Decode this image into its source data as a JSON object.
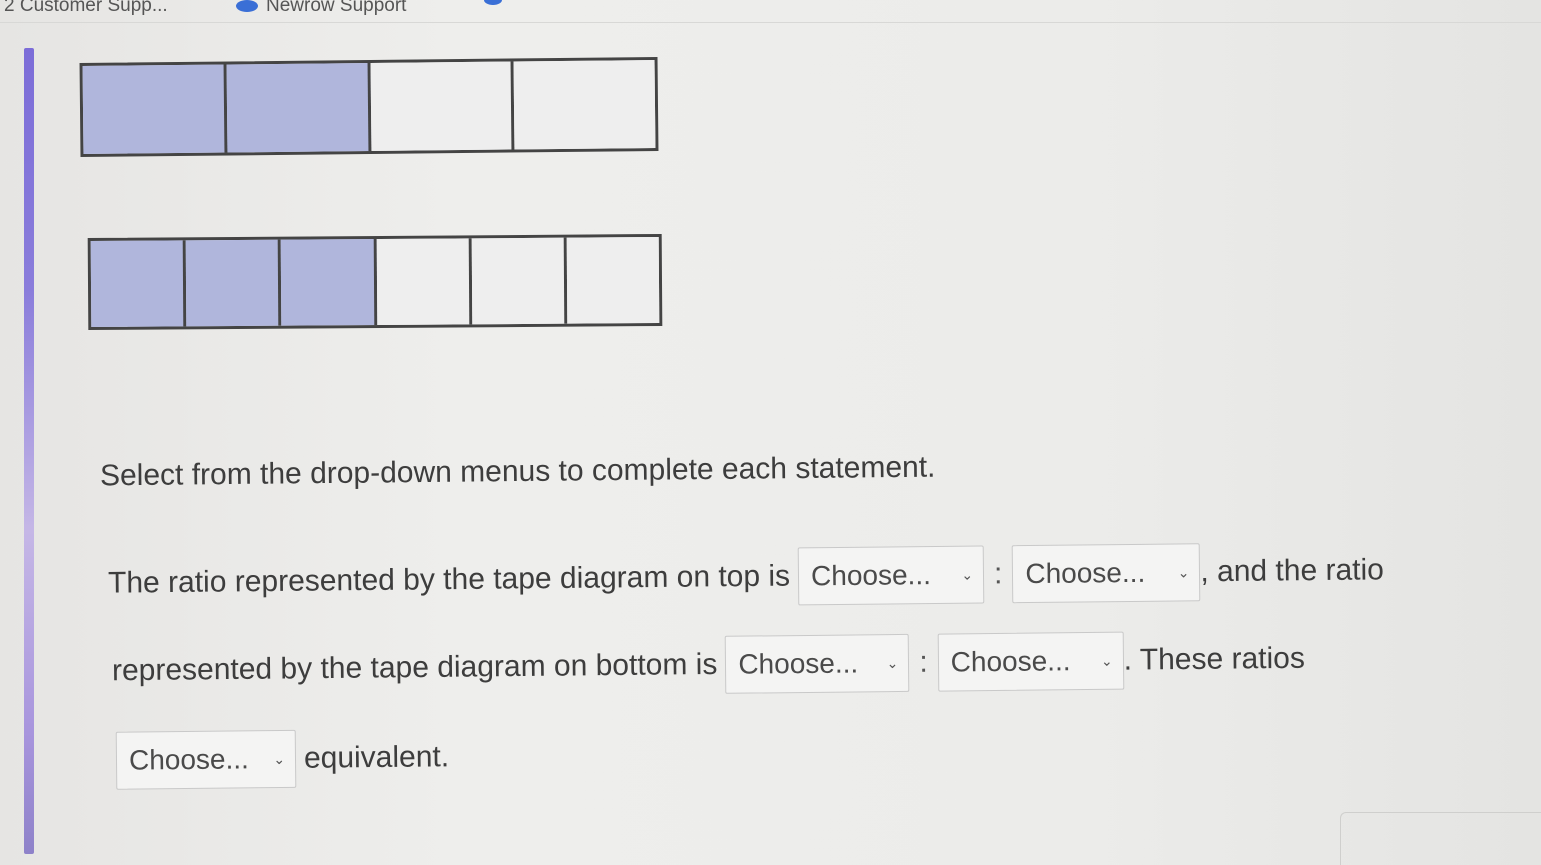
{
  "browser_tabs": [
    {
      "label": "2 Customer Supp...",
      "icon": "cloud-icon"
    },
    {
      "label": "Newrow Support",
      "icon": "cloud-icon"
    }
  ],
  "tape_top": {
    "total_units": 4,
    "shaded_units": 2
  },
  "tape_bottom": {
    "total_units": 6,
    "shaded_units": 3
  },
  "colors": {
    "shaded": "#b0b6dc",
    "accent": "#7c6dd8"
  },
  "question": {
    "instruction": "Select from the drop-down menus to complete each statement.",
    "line1_prefix": "The ratio represented by the tape diagram on top is",
    "line1_suffix": ", and the ratio",
    "line2_prefix": "represented by the tape diagram on bottom is",
    "line2_suffix": ". These ratios",
    "line3_suffix": "equivalent.",
    "colon": ":",
    "select_placeholder": "Choose..."
  }
}
